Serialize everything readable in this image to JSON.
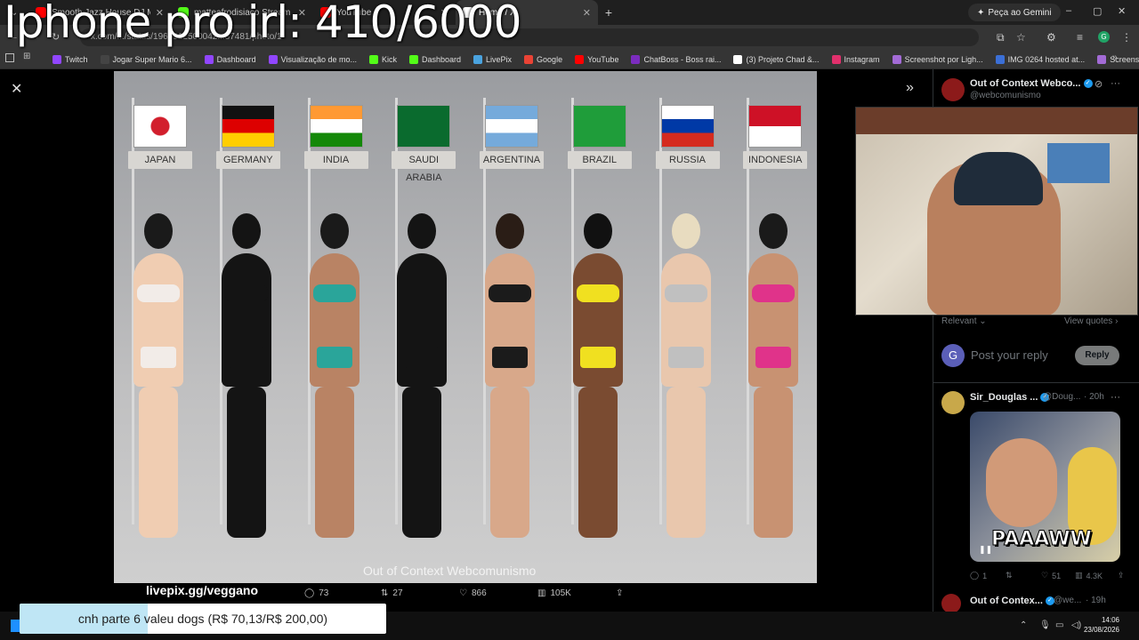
{
  "overlay": {
    "stream_title": "Iphone pro irl: 410/6000",
    "donation_url": "livepix.gg/veggano",
    "donation_text": "cnh parte 6 valeu dogs (R$ 70,13/R$ 200,00)",
    "donation_progress": 0.35
  },
  "browser": {
    "tabs": [
      {
        "title": "Smooth Jazz House DJ Mix - Co",
        "icon": "youtube-icon",
        "color": "#ff0000",
        "active": false
      },
      {
        "title": "matteafrodisiaco Stream - Watc",
        "icon": "kick-icon",
        "color": "#53fc18",
        "active": false
      },
      {
        "title": "YouTube",
        "icon": "youtube-icon",
        "color": "#ff0000",
        "active": false
      },
      {
        "title": "Home / X",
        "icon": "x-icon",
        "color": "#ffffff",
        "active": true
      }
    ],
    "gemini_label": "Peça ao Gemini",
    "url": "x.com/.../status/1960912500042...87481/photo/1",
    "bookmarks": [
      {
        "label": "Twitch",
        "color": "#9146ff"
      },
      {
        "label": "Jogar Super Mario 6...",
        "color": "#444"
      },
      {
        "label": "Dashboard",
        "color": "#9146ff"
      },
      {
        "label": "Visualização de mo...",
        "color": "#9146ff"
      },
      {
        "label": "Kick",
        "color": "#53fc18"
      },
      {
        "label": "Dashboard",
        "color": "#53fc18"
      },
      {
        "label": "LivePix",
        "color": "#4aa3df"
      },
      {
        "label": "Google",
        "color": "#ea4335"
      },
      {
        "label": "YouTube",
        "color": "#ff0000"
      },
      {
        "label": "ChatBoss - Boss rai...",
        "color": "#7b2cbf"
      },
      {
        "label": "(3) Projeto Chad &...",
        "color": "#ffffff"
      },
      {
        "label": "Instagram",
        "color": "#e1306c"
      },
      {
        "label": "Screenshot por Ligh...",
        "color": "#a36bd6"
      },
      {
        "label": "IMG 0264 hosted at...",
        "color": "#3b6fd6"
      },
      {
        "label": "Screenshot por Ligh...",
        "color": "#a36bd6"
      }
    ]
  },
  "photo": {
    "watermark": "Out of Context Webcomunismo",
    "countries": [
      {
        "label": "JAPAN",
        "outfit": "#f2ece8",
        "skin": "#f0cdb2",
        "hair": "#1a1a1a"
      },
      {
        "label": "GERMANY",
        "outfit": "#141414",
        "skin": "#141414",
        "hair": "#141414"
      },
      {
        "label": "INDIA",
        "outfit": "#2aa59a",
        "skin": "#b98364",
        "hair": "#1a1a1a"
      },
      {
        "label": "SAUDI ARABIA",
        "outfit": "#141414",
        "skin": "#141414",
        "hair": "#141414"
      },
      {
        "label": "ARGENTINA",
        "outfit": "#1b1b1b",
        "skin": "#d8a88a",
        "hair": "#2a1d16"
      },
      {
        "label": "BRAZIL",
        "outfit": "#f0e020",
        "skin": "#7a4b31",
        "hair": "#111"
      },
      {
        "label": "RUSSIA",
        "outfit": "#c0c0c0",
        "skin": "#e9c7ad",
        "hair": "#e8dcc0"
      },
      {
        "label": "INDONESIA",
        "outfit": "#e0338a",
        "skin": "#c89272",
        "hair": "#1a1a1a"
      }
    ],
    "stats": {
      "replies": "73",
      "reposts": "27",
      "likes": "866",
      "views": "105K"
    }
  },
  "panel": {
    "author_name": "Out of Context Webco...",
    "author_handle": "@webcomunismo",
    "sort_label": "Relevant",
    "view_quotes": "View quotes",
    "reply_placeholder": "Post your reply",
    "reply_button": "Reply",
    "reply_avatar_letter": "G",
    "comment": {
      "name": "Sir_Douglas ...",
      "handle": "@Doug...",
      "time": "· 20h",
      "caption": "PAAAWW",
      "replies": "1",
      "likes": "51",
      "views": "4.3K"
    },
    "next": {
      "name": "Out of Contex...",
      "handle": "@we...",
      "time": "· 19h"
    }
  },
  "taskbar": {
    "time": "14:06",
    "date": "23/08/2026"
  }
}
